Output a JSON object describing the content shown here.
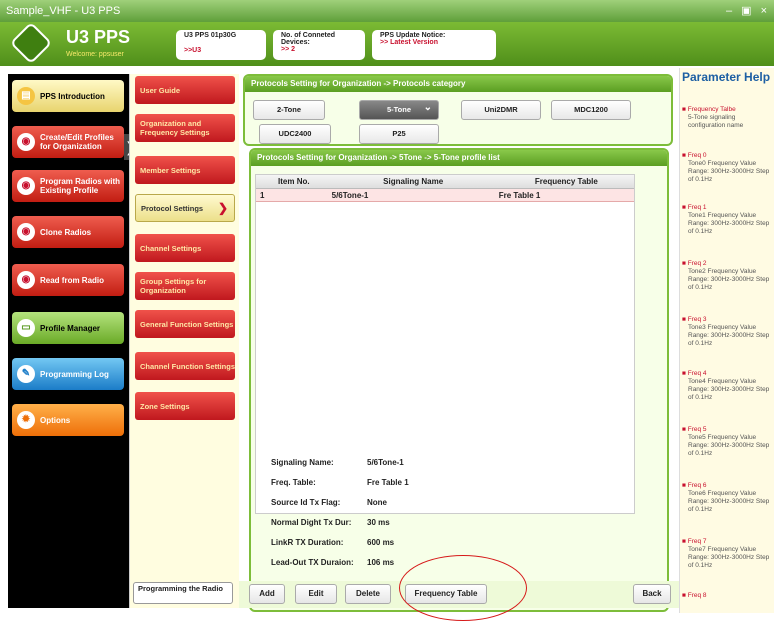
{
  "window": {
    "title": "Sample_VHF - U3 PPS",
    "controls": "– ▣ ×"
  },
  "header": {
    "app_name": "U3 PPS",
    "welcome": "Welcome: ppsuser",
    "info": [
      {
        "title": "U3 PPS 01p30G",
        "value": ">>U3"
      },
      {
        "title": "No. of Conneted Devices:",
        "value": ">> 2"
      },
      {
        "title": "PPS Update Notice:",
        "value": ">> Latest Version"
      }
    ]
  },
  "leftnav": {
    "items": [
      {
        "label": "PPS Introduction",
        "icon": "document-icon"
      },
      {
        "label": "Create/Edit Profiles for Organization",
        "icon": "radio-icon"
      },
      {
        "label": "Program Radios with Existing Profile",
        "icon": "radio-icon"
      },
      {
        "label": "Clone Radios",
        "icon": "radio-icon"
      },
      {
        "label": "Read from Radio",
        "icon": "radio-icon"
      },
      {
        "label": "Profile Manager",
        "icon": "folder-icon"
      },
      {
        "label": "Programming Log",
        "icon": "log-icon"
      },
      {
        "label": "Options",
        "icon": "gear-icon"
      }
    ],
    "selector": "❯"
  },
  "subnav": {
    "items": [
      "User Guide",
      "Organization and Frequency Settings",
      "Member Settings",
      "Protocol Settings",
      "Channel Settings",
      "Group Settings for Organization",
      "General Function Settings",
      "Channel Function Settings",
      "Zone Settings"
    ],
    "bottom": "Programming the Radio"
  },
  "protocols": {
    "header": "Protocols Setting for Organization -> Protocols category",
    "buttons": [
      "2-Tone",
      "5-Tone",
      "Uni2DMR",
      "MDC1200",
      "UDC2400",
      "P25"
    ],
    "selected_chevron": "⌄"
  },
  "profile_list": {
    "header": "Protocols Setting for Organization -> 5Tone -> 5-Tone profile list",
    "columns": [
      "Item No.",
      "Signaling Name",
      "Frequency Table"
    ],
    "rows": [
      {
        "item": "1",
        "name": "5/6Tone-1",
        "freq": "Fre Table 1"
      }
    ]
  },
  "details": [
    {
      "label": "Signaling Name:",
      "value": "5/6Tone-1"
    },
    {
      "label": "Freq. Table:",
      "value": "Fre Table 1"
    },
    {
      "label": "Source Id Tx Flag:",
      "value": "None"
    },
    {
      "label": "Normal Dight Tx Dur:",
      "value": "30  ms"
    },
    {
      "label": "LinkR TX Duration:",
      "value": "600  ms"
    },
    {
      "label": "Lead-Out TX Duraion:",
      "value": "106  ms"
    }
  ],
  "bottom_buttons": [
    "Add",
    "Edit",
    "Delete",
    "Frequency Table",
    "Back"
  ],
  "help": {
    "title": "Parameter Help",
    "items": [
      {
        "name": "Frequency Talbe",
        "desc": "5-Tone signaling configuration name"
      },
      {
        "name": "Freq 0",
        "desc": "Tone0 Frequency Value Range: 300Hz-3000Hz Step of 0.1Hz"
      },
      {
        "name": "Freq 1",
        "desc": "Tone1 Frequency Value Range: 300Hz-3000Hz Step of 0.1Hz"
      },
      {
        "name": "Freq 2",
        "desc": "Tone2 Frequency Value Range: 300Hz-3000Hz Step of 0.1Hz"
      },
      {
        "name": "Freq 3",
        "desc": "Tone3 Frequency Value Range: 300Hz-3000Hz Step of 0.1Hz"
      },
      {
        "name": "Freq 4",
        "desc": "Tone4 Frequency Value Range: 300Hz-3000Hz Step of 0.1Hz"
      },
      {
        "name": "Freq 5",
        "desc": "Tone5 Frequency Value Range: 300Hz-3000Hz Step of 0.1Hz"
      },
      {
        "name": "Freq 6",
        "desc": "Tone6 Frequency Value Range: 300Hz-3000Hz Step of 0.1Hz"
      },
      {
        "name": "Freq 7",
        "desc": "Tone7 Frequency Value Range: 300Hz-3000Hz Step of 0.1Hz"
      },
      {
        "name": "Freq 8",
        "desc": ""
      }
    ],
    "bullet": "■"
  }
}
